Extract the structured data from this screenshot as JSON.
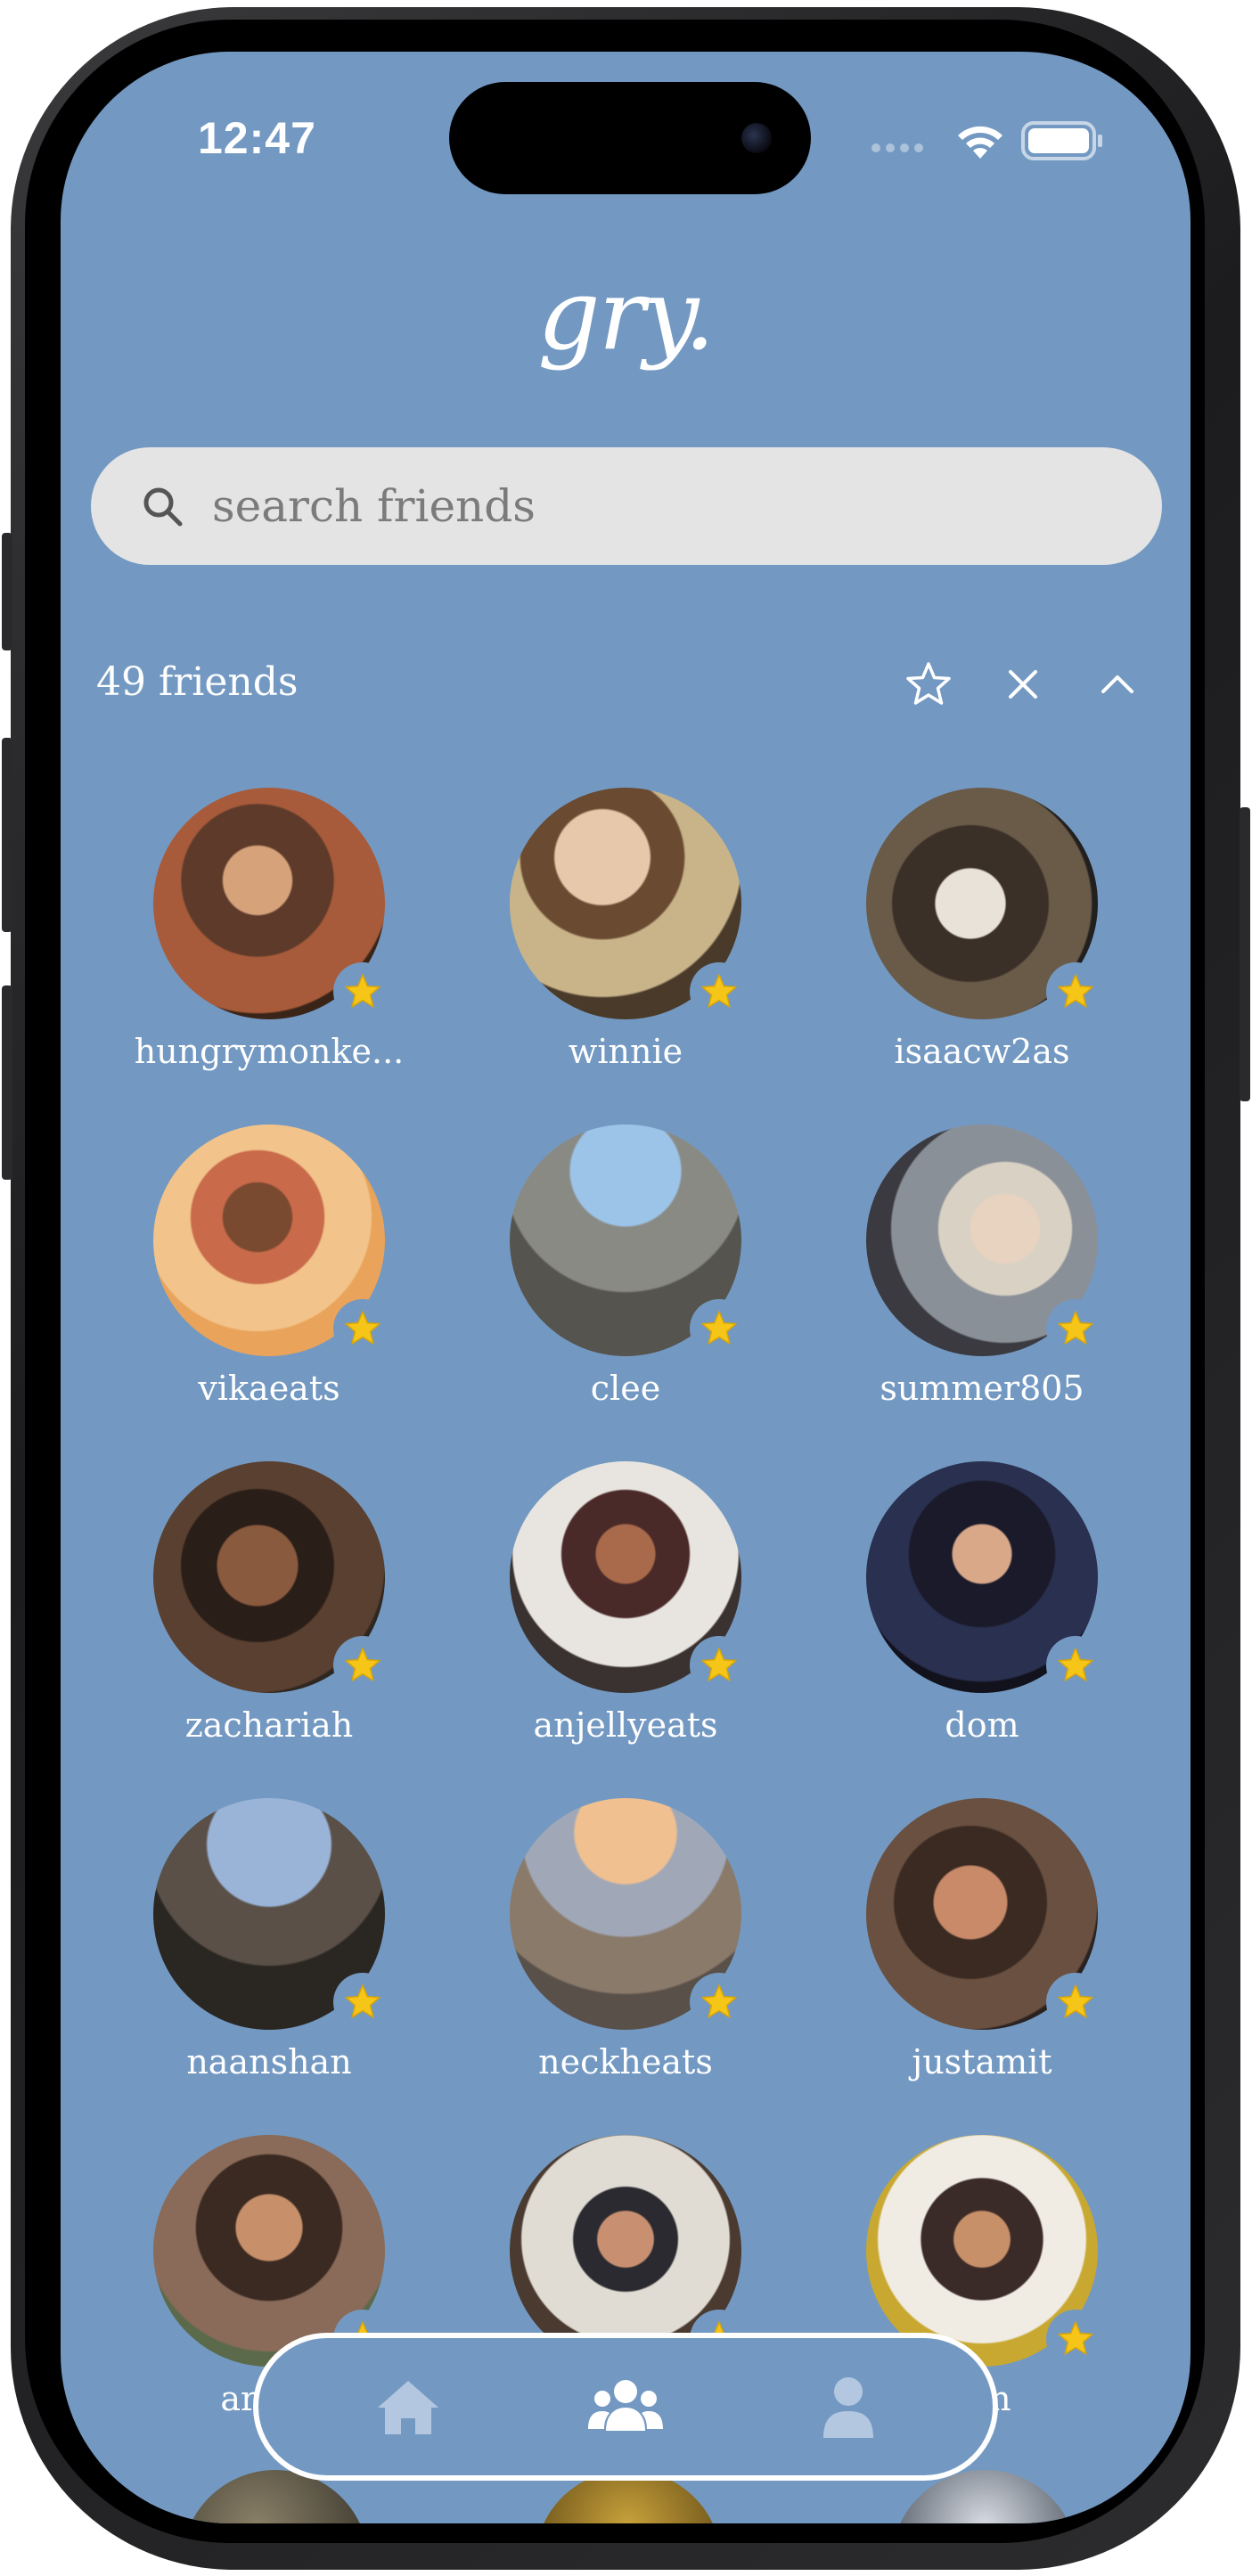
{
  "status_bar": {
    "time": "12:47",
    "icons": [
      "cellular-dots-icon",
      "wifi-icon",
      "battery-icon"
    ]
  },
  "app": {
    "logo": "gry."
  },
  "search": {
    "placeholder": "search friends",
    "value": ""
  },
  "friends_header": {
    "count_label": "49 friends",
    "actions": [
      "star-icon",
      "close-icon",
      "chevron-up-icon"
    ]
  },
  "friends": [
    {
      "name": "hungrymonke...",
      "favorite": true
    },
    {
      "name": "winnie",
      "favorite": true
    },
    {
      "name": "isaacw2as",
      "favorite": true
    },
    {
      "name": "vikaeats",
      "favorite": true
    },
    {
      "name": "clee",
      "favorite": true
    },
    {
      "name": "summer805",
      "favorite": true
    },
    {
      "name": "zachariah",
      "favorite": true
    },
    {
      "name": "anjellyeats",
      "favorite": true
    },
    {
      "name": "dom",
      "favorite": true
    },
    {
      "name": "naanshan",
      "favorite": true
    },
    {
      "name": "neckheats",
      "favorite": true
    },
    {
      "name": "justamit",
      "favorite": true
    },
    {
      "name": "archa",
      "favorite": true
    },
    {
      "name": "",
      "favorite": true
    },
    {
      "name": "ran",
      "favorite": true
    }
  ],
  "tab_bar": {
    "tabs": [
      {
        "icon": "home-icon",
        "active": false
      },
      {
        "icon": "friends-icon",
        "active": true
      },
      {
        "icon": "profile-icon",
        "active": false
      }
    ]
  },
  "colors": {
    "background": "#7399c2",
    "search_bg": "#e4e4e4",
    "text": "#ffffff",
    "star": "#f5c518"
  }
}
